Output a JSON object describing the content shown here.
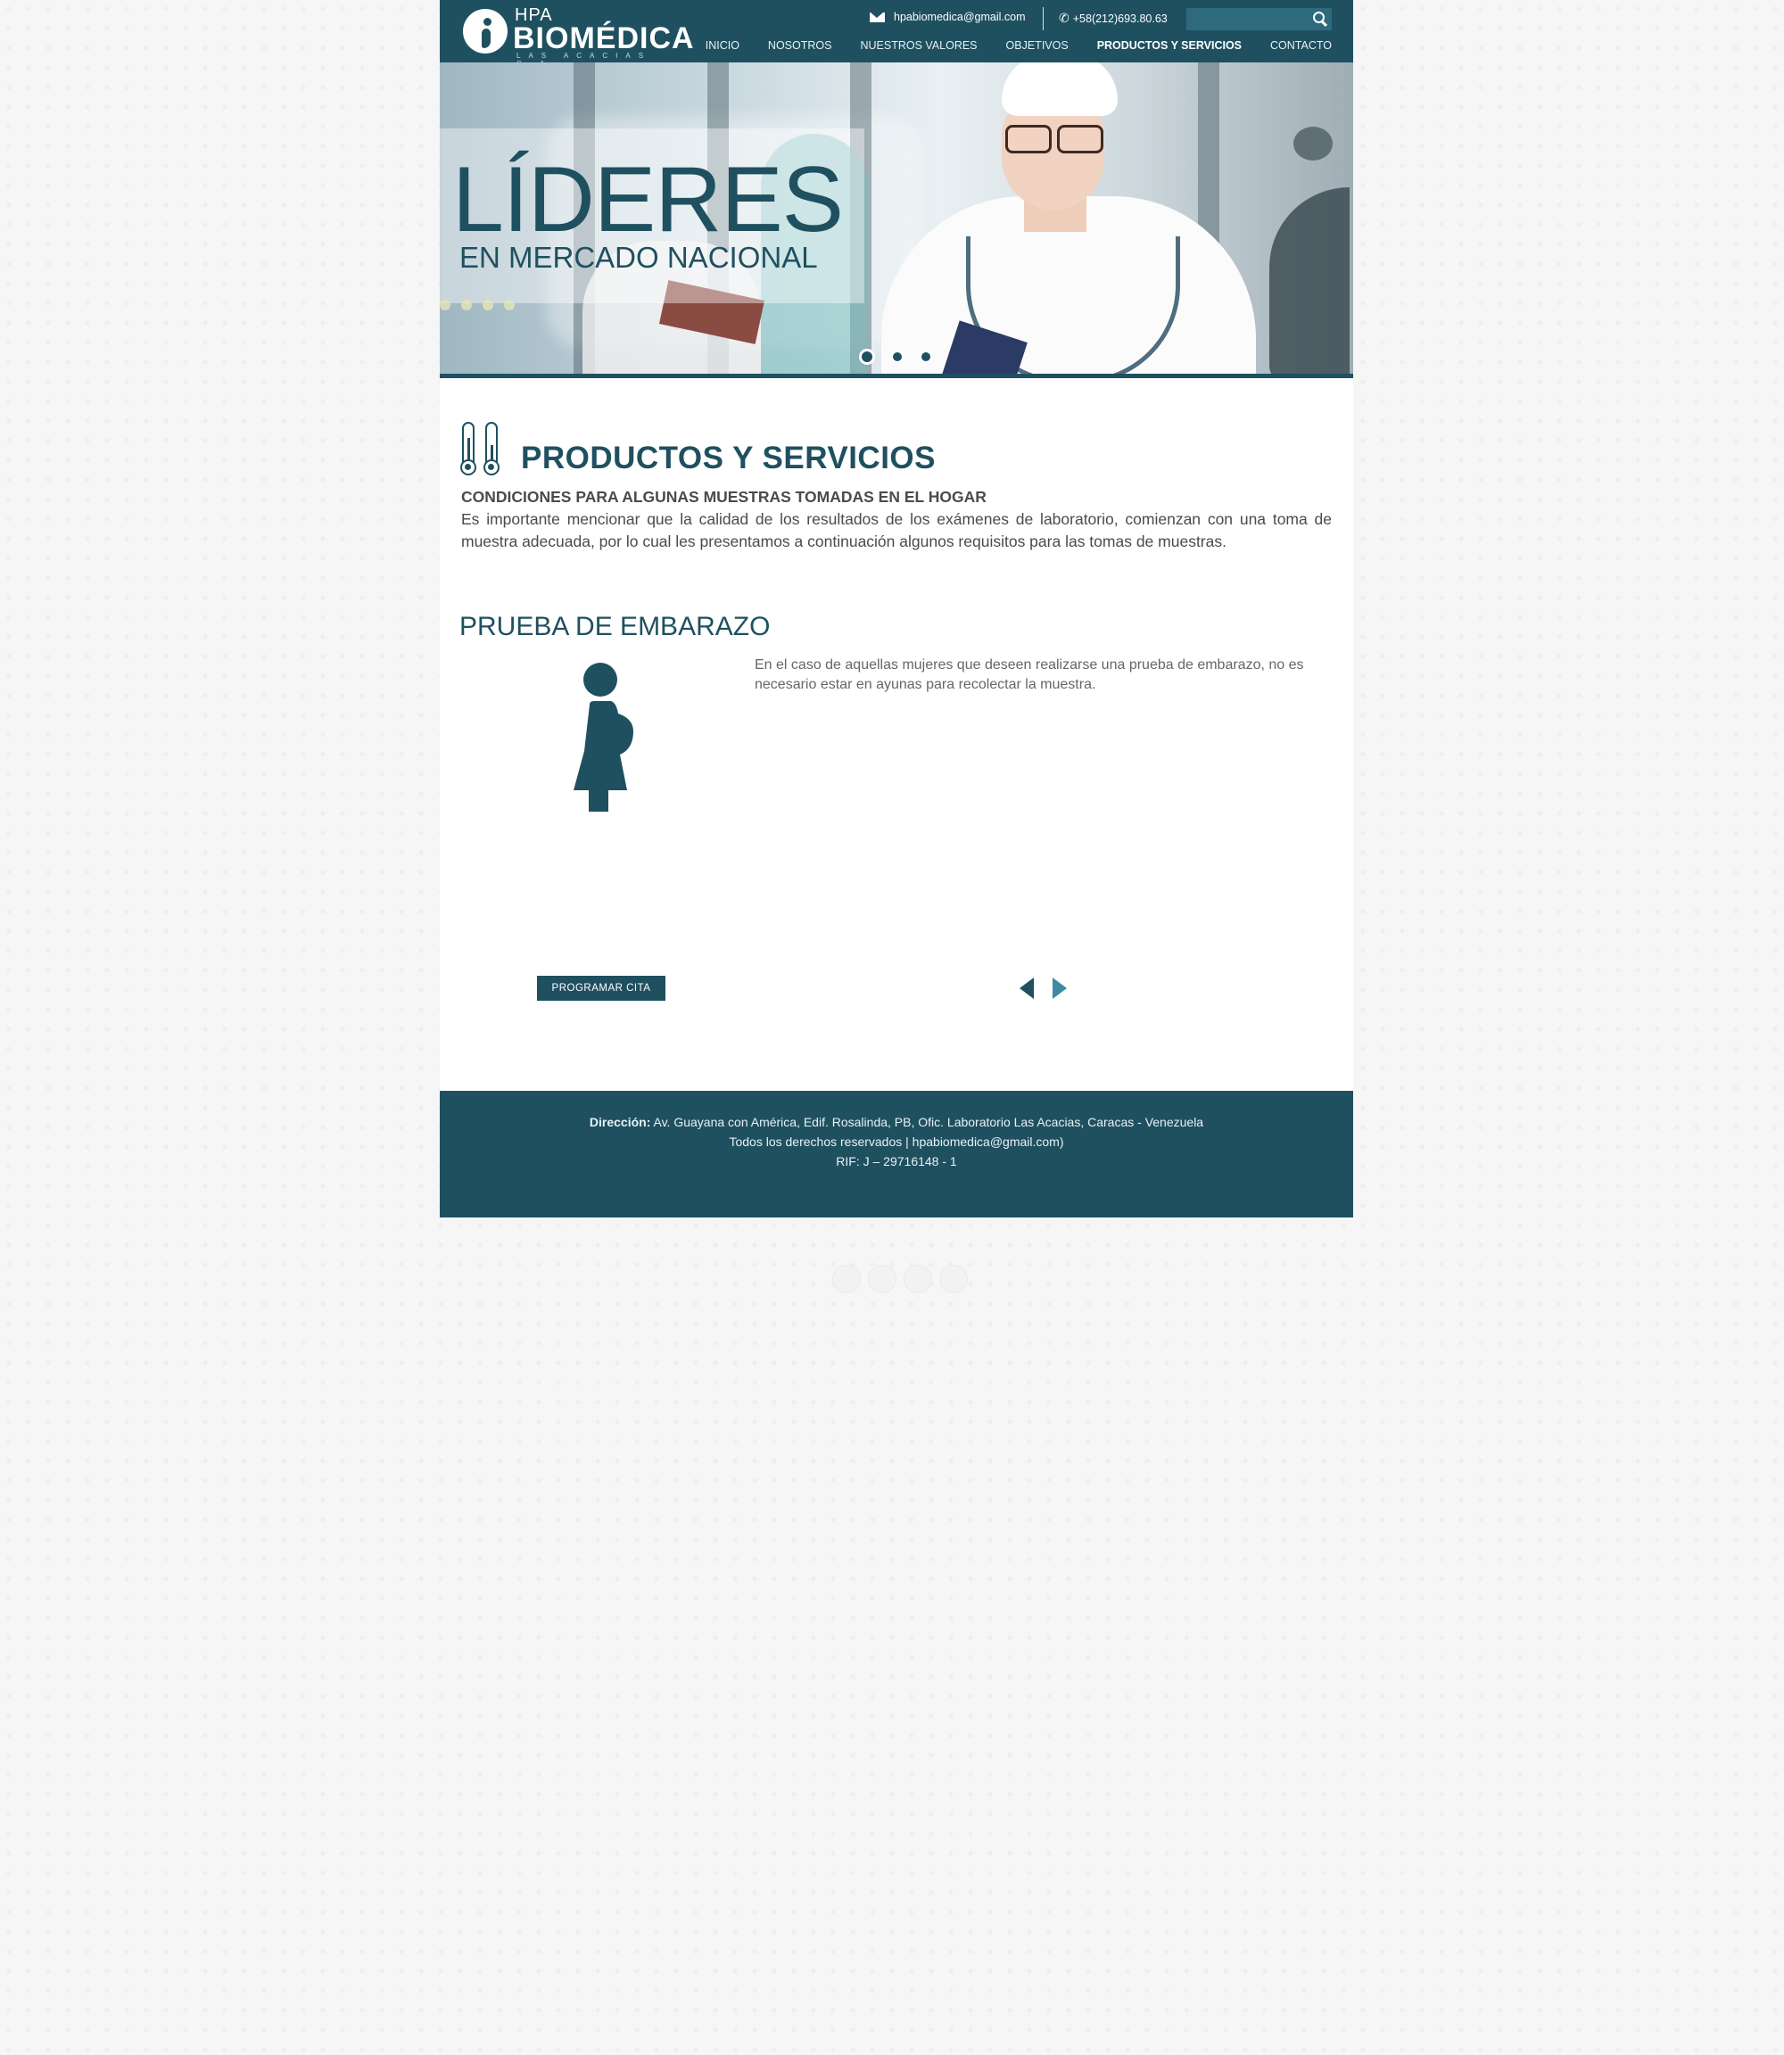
{
  "header": {
    "logo": {
      "hpa": "HPA",
      "brand": "BIOMÉDICA",
      "sub": "LAS ACACIAS C.A"
    },
    "email": "hpabiomedica@gmail.com",
    "phone": "+58(212)693.80.63",
    "search": {
      "value": "",
      "placeholder": ""
    },
    "nav": [
      {
        "label": "INICIO",
        "active": false
      },
      {
        "label": "NOSOTROS",
        "active": false
      },
      {
        "label": "NUESTROS VALORES",
        "active": false
      },
      {
        "label": "OBJETIVOS",
        "active": false
      },
      {
        "label": "PRODUCTOS Y SERVICIOS",
        "active": true
      },
      {
        "label": "CONTACTO",
        "active": false
      }
    ]
  },
  "hero": {
    "title": "LÍDERES",
    "subtitle": "EN MERCADO NACIONAL",
    "slides_count": 3,
    "active_slide": 1
  },
  "content": {
    "title": "PRODUCTOS Y SERVICIOS",
    "subtitle": "CONDICIONES PARA ALGUNAS MUESTRAS TOMADAS EN EL HOGAR",
    "intro": "Es importante mencionar que la calidad de los resultados de los exámenes de laboratorio, comienzan con una toma de muestra adecuada, por lo cual les presentamos a continuación algunos requisitos para las tomas de muestras.",
    "test": {
      "title": "PRUEBA DE EMBARAZO",
      "icon": "pregnant-woman-icon",
      "description": "En el caso de aquellas mujeres que deseen realizarse una prueba de embarazo, no es necesario estar en ayunas para recolectar la muestra."
    },
    "button_label": "PROGRAMAR CITA"
  },
  "footer": {
    "address_label": "Dirección:",
    "address": "Av. Guayana con América, Edif. Rosalinda, PB, Ofic. Laboratorio Las Acacias, Caracas - Venezuela",
    "rights": "Todos los derechos reservados | hpabiomedica@gmail.com)",
    "rif": "RIF: J – 29716148 - 1"
  },
  "colors": {
    "primary": "#1f5060",
    "accent": "#3d8aa3",
    "background": "#f6f6f6"
  }
}
